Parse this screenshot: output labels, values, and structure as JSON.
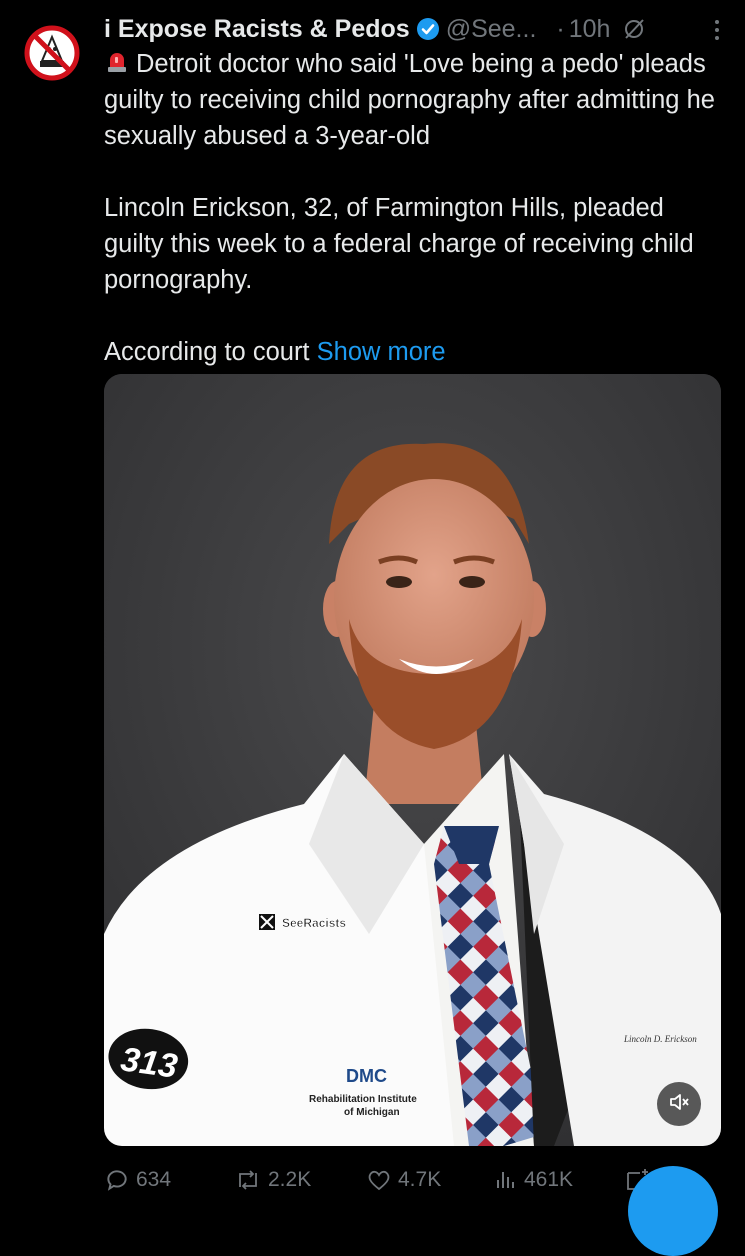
{
  "tweet": {
    "display_name": "i Expose Racists & Pedos",
    "handle": "@See...",
    "separator": "·",
    "time": "10h",
    "headline": "Detroit doctor who said 'Love being a pedo' pleads guilty to receiving child pornography after admitting he sexually abused a 3-year-old",
    "paragraph2": "Lincoln Erickson, 32, of Farmington Hills, pleaded guilty this week to a federal charge of receiving child pornography.",
    "paragraph3": "According to court",
    "show_more": "Show more"
  },
  "media": {
    "watermark": "SeeRacists",
    "coat_patch": "313",
    "coat_logo": "DMC",
    "coat_line1": "Rehabilitation Institute",
    "coat_line2": "of Michigan",
    "coat_name": "Lincoln D. Erickson"
  },
  "actions": {
    "replies": "634",
    "reposts": "2.2K",
    "likes": "4.7K",
    "views": "461K"
  },
  "icons": {
    "verified": "verified-badge-icon",
    "siren": "police-siren-icon",
    "grok": "grok-icon",
    "more": "more-options-icon",
    "reply": "reply-icon",
    "repost": "repost-icon",
    "like": "heart-icon",
    "views": "views-chart-icon",
    "share": "share-icon",
    "mute": "muted-speaker-icon"
  },
  "colors": {
    "background": "#000000",
    "text": "#e7e9ea",
    "secondary": "#71767b",
    "accent": "#1d9bf0"
  }
}
